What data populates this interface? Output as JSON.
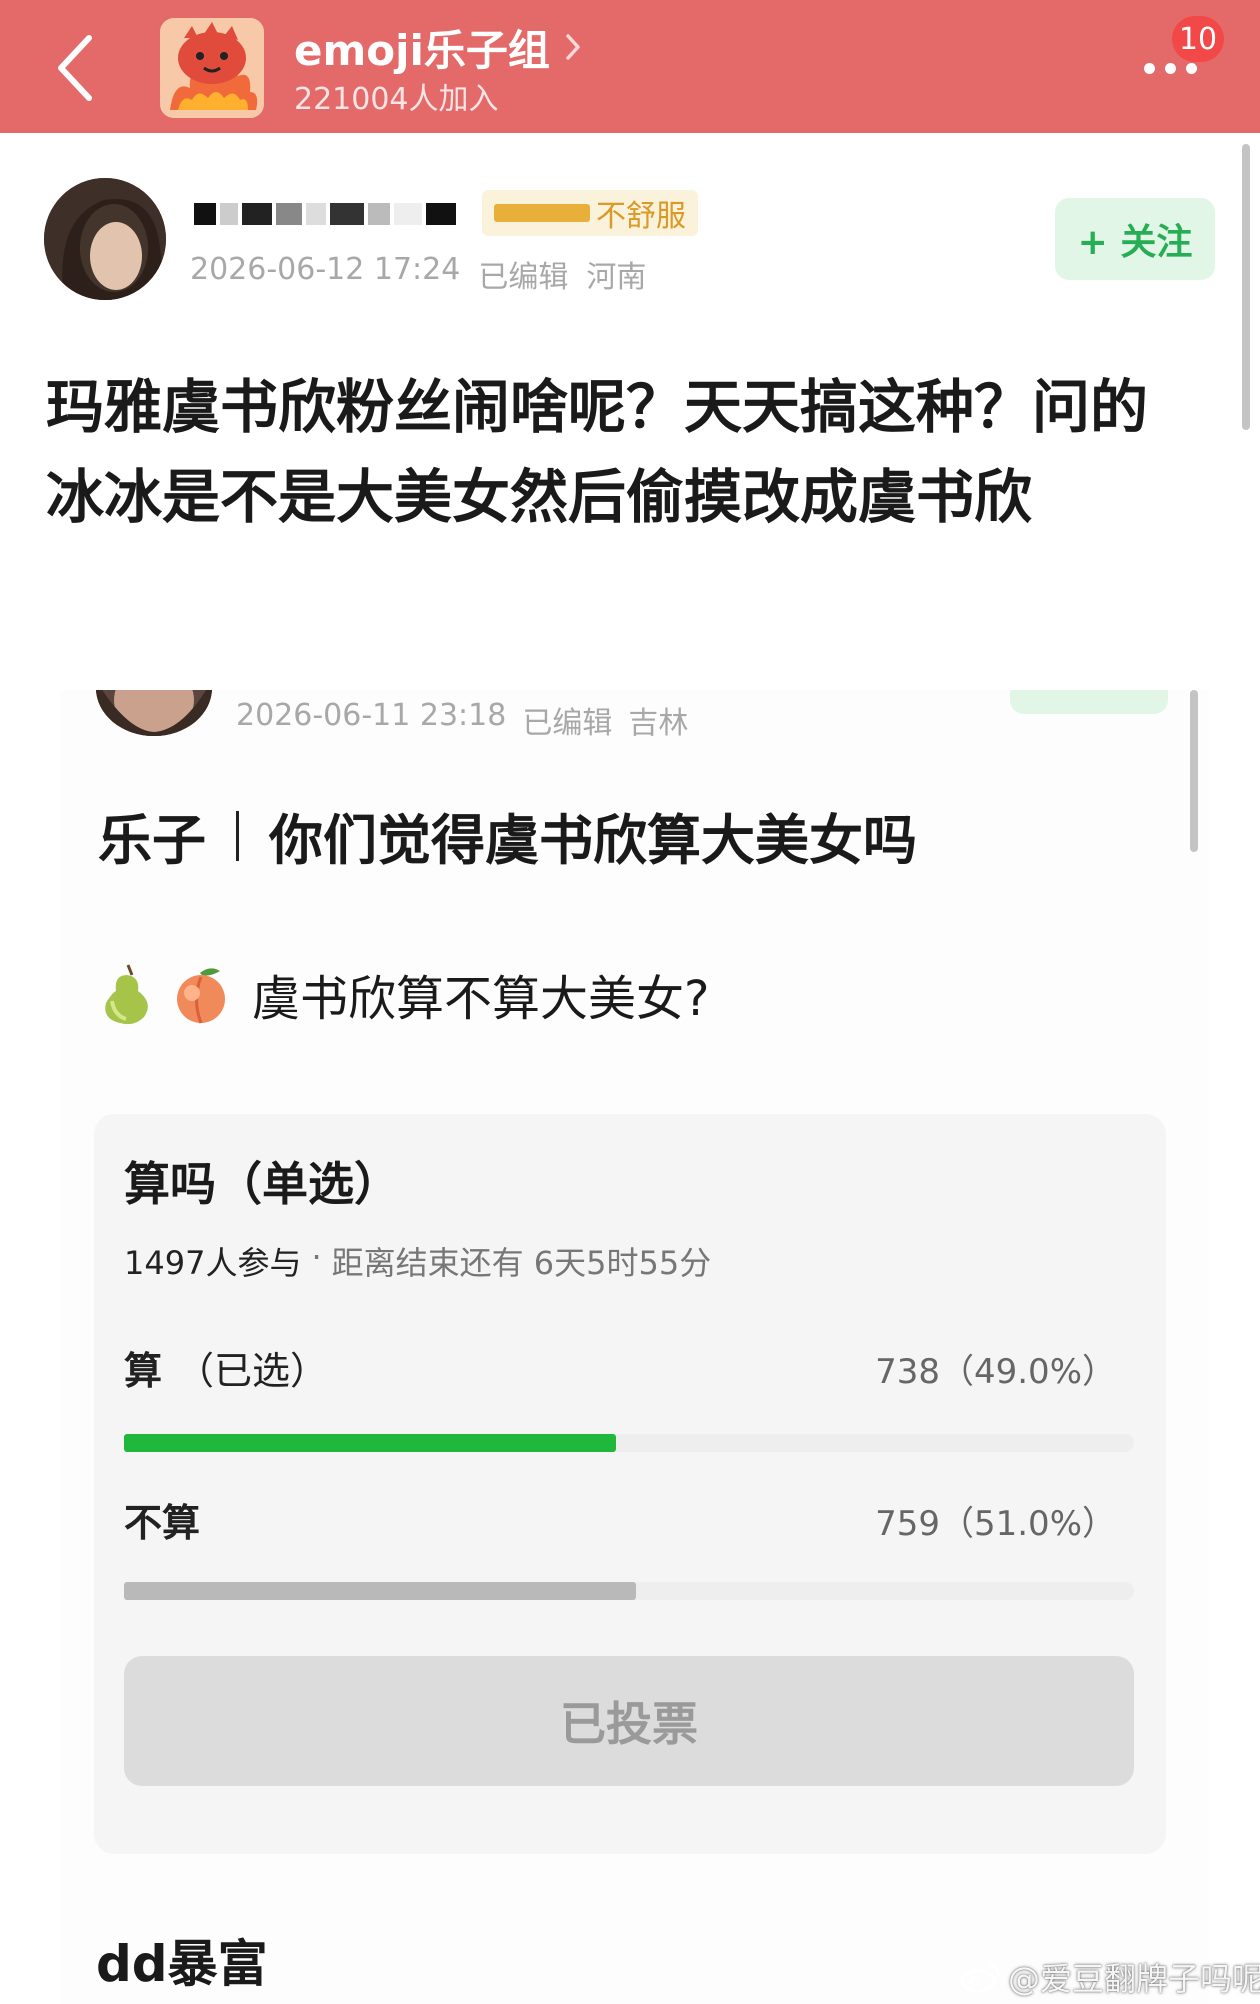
{
  "header": {
    "group_name": "emoji乐子组",
    "member_count": "221004人加入",
    "notification_count": "10"
  },
  "post": {
    "author_flair": "不舒服",
    "timestamp": "2026-06-12 17:24",
    "edited_label": "已编辑",
    "location": "河南",
    "follow_label": "+ 关注",
    "title": "玛雅虞书欣粉丝闹啥呢？天天搞这种？问的冰冰是不是大美女然后偷摸改成虞书欣"
  },
  "embedded_post": {
    "timestamp": "2026-06-11 23:18",
    "edited_label": "已编辑",
    "location": "吉林",
    "category": "乐子",
    "title": "你们觉得虞书欣算大美女吗",
    "question": "虞书欣算不算大美女?",
    "emojis": [
      "pear-emoji",
      "peach-emoji"
    ],
    "below_card_text": "dd暴富"
  },
  "poll": {
    "title": "算吗（单选）",
    "participants": "1497人参与",
    "separator": "·",
    "deadline": "距离结束还有 6天5时55分",
    "options": [
      {
        "label": "算",
        "chosen_label": "（已选）",
        "value": "738（49.0%）",
        "fraction": 0.49,
        "color": "#1fb83c"
      },
      {
        "label": "不算",
        "chosen_label": "",
        "value": "759（51.0%）",
        "fraction": 0.51,
        "color": "#b9b9b9"
      }
    ],
    "voted_label": "已投票"
  },
  "watermark": {
    "text": "@爱豆翻牌子吗呢"
  },
  "colors": {
    "header_bg": "#e46a6a",
    "follow_green": "#27ae55",
    "follow_bg": "#e1f6e6",
    "poll_chosen": "#1fb83c",
    "poll_other": "#b9b9b9"
  }
}
